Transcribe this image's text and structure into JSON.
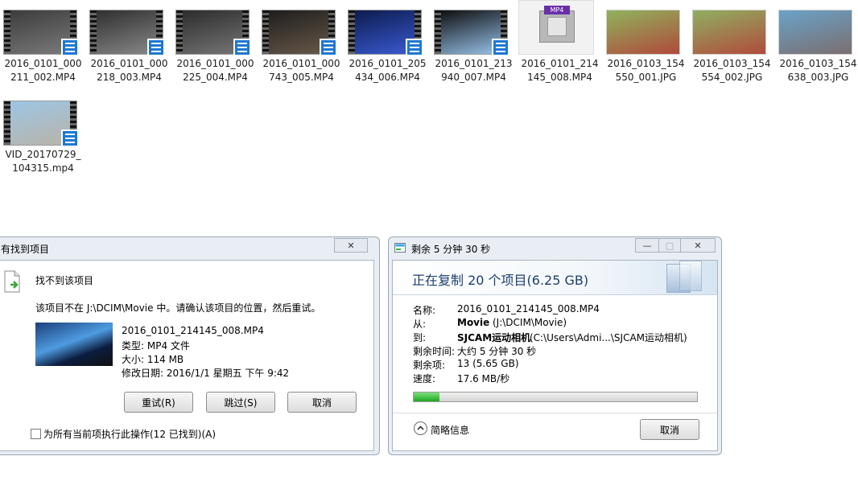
{
  "files": [
    {
      "name_line1": "2016_0101_000",
      "name_line2": "211_002.MP4",
      "kind": "video",
      "colors": [
        "#3a3a3a",
        "#7c7c7c"
      ]
    },
    {
      "name_line1": "2016_0101_000",
      "name_line2": "218_003.MP4",
      "kind": "video",
      "colors": [
        "#2d2d2d",
        "#8a8a8a"
      ]
    },
    {
      "name_line1": "2016_0101_000",
      "name_line2": "225_004.MP4",
      "kind": "video",
      "colors": [
        "#2a2a2a",
        "#777777"
      ]
    },
    {
      "name_line1": "2016_0101_000",
      "name_line2": "743_005.MP4",
      "kind": "video",
      "colors": [
        "#1c1c1c",
        "#6a5a4a"
      ]
    },
    {
      "name_line1": "2016_0101_205",
      "name_line2": "434_006.MP4",
      "kind": "video",
      "colors": [
        "#0b1a4a",
        "#3b5bd6"
      ]
    },
    {
      "name_line1": "2016_0101_213",
      "name_line2": "940_007.MP4",
      "kind": "video",
      "colors": [
        "#0a0a0a",
        "#9bc7ef"
      ]
    },
    {
      "name_line1": "2016_0101_214",
      "name_line2": "145_008.MP4",
      "kind": "mp4-generic",
      "colors": [
        "#f2f2f2",
        "#f2f2f2"
      ]
    },
    {
      "name_line1": "2016_0103_154",
      "name_line2": "550_001.JPG",
      "kind": "photo",
      "colors": [
        "#8fb35d",
        "#b04a3b"
      ]
    },
    {
      "name_line1": "2016_0103_154",
      "name_line2": "554_002.JPG",
      "kind": "photo",
      "colors": [
        "#8fb061",
        "#b14b3c"
      ]
    },
    {
      "name_line1": "2016_0103_154",
      "name_line2": "638_003.JPG",
      "kind": "photo",
      "colors": [
        "#6aa3c9",
        "#7a6e6e"
      ]
    },
    {
      "name_line1": "VID_20170729_",
      "name_line2": "104315.mp4",
      "kind": "video",
      "colors": [
        "#9cc6e6",
        "#b9b3a6"
      ]
    }
  ],
  "mp4_tag": "MP4",
  "not_found": {
    "title": "有找到项目",
    "close_glyph": "✕",
    "heading": "找不到该项目",
    "message": "该项目不在 J:\\DCIM\\Movie 中。请确认该项目的位置，然后重试。",
    "file_name": "2016_0101_214145_008.MP4",
    "type_line": "类型: MP4 文件",
    "size_line": "大小: 114 MB",
    "date_line": "修改日期: 2016/1/1 星期五 下午 9:42",
    "retry": "重试(R)",
    "skip": "跳过(S)",
    "cancel": "取消",
    "apply_all": "为所有当前项执行此操作(12 已找到)(A)"
  },
  "copy": {
    "title": "剩余 5 分钟 30 秒",
    "header": "正在复制 20 个项目(6.25 GB)",
    "name_label": "名称:",
    "name_value": "2016_0101_214145_008.MP4",
    "from_label": "从:",
    "from_bold": "Movie",
    "from_rest": "(J:\\DCIM\\Movie)",
    "to_label": "到:",
    "to_bold": "SJCAM运动相机",
    "to_rest": "(C:\\Users\\Admi...\\SJCAM运动相机)",
    "remaining_time_label": "剩余时间:",
    "remaining_time_value": "大约 5 分钟 30 秒",
    "remaining_items_label": "剩余项:",
    "remaining_items_value": "13 (5.65 GB)",
    "speed_label": "速度:",
    "speed_value": "17.6 MB/秒",
    "progress_fraction": 0.09,
    "less_info": "简略信息",
    "cancel": "取消",
    "min_glyph": "—",
    "max_glyph": "□",
    "close_glyph": "✕"
  },
  "colors": {
    "progress": "#2cbb2c",
    "header_bg": "#3c6fa8",
    "accent_badge": "#1f78d1"
  }
}
